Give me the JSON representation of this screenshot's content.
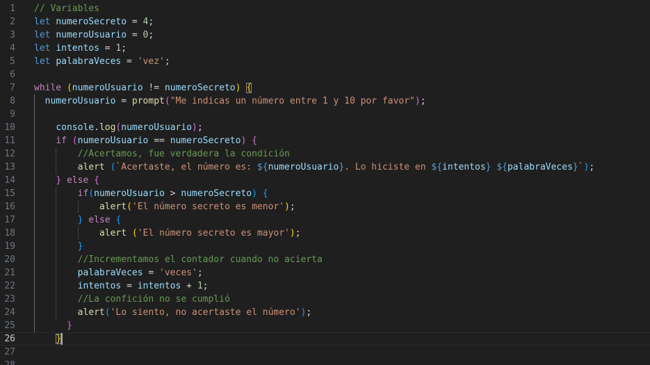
{
  "editor": {
    "language": "javascript",
    "active_line": 26,
    "lines": [
      {
        "n": "1",
        "indent": 0,
        "tokens": [
          {
            "t": "com",
            "v": "// Variables"
          }
        ]
      },
      {
        "n": "2",
        "indent": 0,
        "tokens": [
          {
            "t": "kw",
            "v": "let "
          },
          {
            "t": "var",
            "v": "numeroSecreto"
          },
          {
            "t": "op",
            "v": " = "
          },
          {
            "t": "num",
            "v": "4"
          },
          {
            "t": "op",
            "v": ";"
          }
        ]
      },
      {
        "n": "3",
        "indent": 0,
        "tokens": [
          {
            "t": "kw",
            "v": "let "
          },
          {
            "t": "var",
            "v": "numeroUsuario"
          },
          {
            "t": "op",
            "v": " = "
          },
          {
            "t": "num",
            "v": "0"
          },
          {
            "t": "op",
            "v": ";"
          }
        ]
      },
      {
        "n": "4",
        "indent": 0,
        "tokens": [
          {
            "t": "kw",
            "v": "let "
          },
          {
            "t": "var",
            "v": "intentos"
          },
          {
            "t": "op",
            "v": " = "
          },
          {
            "t": "num",
            "v": "1"
          },
          {
            "t": "op",
            "v": ";"
          }
        ]
      },
      {
        "n": "5",
        "indent": 0,
        "tokens": [
          {
            "t": "kw",
            "v": "let "
          },
          {
            "t": "var",
            "v": "palabraVeces"
          },
          {
            "t": "op",
            "v": " = "
          },
          {
            "t": "str",
            "v": "'vez'"
          },
          {
            "t": "op",
            "v": ";"
          }
        ]
      },
      {
        "n": "6",
        "indent": 0,
        "tokens": []
      },
      {
        "n": "7",
        "indent": 0,
        "tokens": [
          {
            "t": "ctrl",
            "v": "while "
          },
          {
            "t": "b1",
            "v": "("
          },
          {
            "t": "var",
            "v": "numeroUsuario"
          },
          {
            "t": "op",
            "v": " != "
          },
          {
            "t": "var",
            "v": "numeroSecreto"
          },
          {
            "t": "b1",
            "v": ")"
          },
          {
            "t": "op",
            "v": " "
          },
          {
            "t": "b1",
            "v": "{",
            "match": true
          }
        ]
      },
      {
        "n": "8",
        "indent": 2,
        "tokens": [
          {
            "t": "var",
            "v": "numeroUsuario"
          },
          {
            "t": "op",
            "v": " = "
          },
          {
            "t": "fn",
            "v": "prompt"
          },
          {
            "t": "b2",
            "v": "("
          },
          {
            "t": "str",
            "v": "\"Me indicas un número entre 1 y 10 por favor\""
          },
          {
            "t": "b2",
            "v": ")"
          },
          {
            "t": "op",
            "v": ";"
          }
        ]
      },
      {
        "n": "9",
        "indent": 0,
        "tokens": []
      },
      {
        "n": "10",
        "indent": 4,
        "tokens": [
          {
            "t": "var",
            "v": "console"
          },
          {
            "t": "op",
            "v": "."
          },
          {
            "t": "fn",
            "v": "log"
          },
          {
            "t": "b2",
            "v": "("
          },
          {
            "t": "var",
            "v": "numeroUsuario"
          },
          {
            "t": "b2",
            "v": ")"
          },
          {
            "t": "op",
            "v": ";"
          }
        ]
      },
      {
        "n": "11",
        "indent": 4,
        "tokens": [
          {
            "t": "ctrl",
            "v": "if "
          },
          {
            "t": "b2",
            "v": "("
          },
          {
            "t": "var",
            "v": "numeroUsuario"
          },
          {
            "t": "op",
            "v": " == "
          },
          {
            "t": "var",
            "v": "numeroSecreto"
          },
          {
            "t": "b2",
            "v": ")"
          },
          {
            "t": "op",
            "v": " "
          },
          {
            "t": "b2",
            "v": "{"
          }
        ]
      },
      {
        "n": "12",
        "indent": 8,
        "tokens": [
          {
            "t": "com",
            "v": "//Acertamos, fue verdadera la condición"
          }
        ]
      },
      {
        "n": "13",
        "indent": 8,
        "tokens": [
          {
            "t": "fn",
            "v": "alert"
          },
          {
            "t": "op",
            "v": " "
          },
          {
            "t": "b3",
            "v": "("
          },
          {
            "t": "str",
            "v": "`Acertaste, el número es: "
          },
          {
            "t": "tmpl",
            "v": "${"
          },
          {
            "t": "var",
            "v": "numeroUsuario"
          },
          {
            "t": "tmpl",
            "v": "}"
          },
          {
            "t": "str",
            "v": ". Lo hiciste en "
          },
          {
            "t": "tmpl",
            "v": "${"
          },
          {
            "t": "var",
            "v": "intentos"
          },
          {
            "t": "tmpl",
            "v": "}"
          },
          {
            "t": "str",
            "v": " "
          },
          {
            "t": "tmpl",
            "v": "${"
          },
          {
            "t": "var",
            "v": "palabraVeces"
          },
          {
            "t": "tmpl",
            "v": "}"
          },
          {
            "t": "str",
            "v": "`"
          },
          {
            "t": "b3",
            "v": ")"
          },
          {
            "t": "op",
            "v": ";"
          }
        ]
      },
      {
        "n": "14",
        "indent": 4,
        "tokens": [
          {
            "t": "b2",
            "v": "}"
          },
          {
            "t": "op",
            "v": " "
          },
          {
            "t": "ctrl",
            "v": "else "
          },
          {
            "t": "b2",
            "v": "{"
          }
        ]
      },
      {
        "n": "15",
        "indent": 8,
        "tokens": [
          {
            "t": "ctrl",
            "v": "if"
          },
          {
            "t": "b3",
            "v": "("
          },
          {
            "t": "var",
            "v": "numeroUsuario"
          },
          {
            "t": "op",
            "v": " > "
          },
          {
            "t": "var",
            "v": "numeroSecreto"
          },
          {
            "t": "b3",
            "v": ")"
          },
          {
            "t": "op",
            "v": " "
          },
          {
            "t": "b3",
            "v": "{"
          }
        ]
      },
      {
        "n": "16",
        "indent": 12,
        "tokens": [
          {
            "t": "fn",
            "v": "alert"
          },
          {
            "t": "b1",
            "v": "("
          },
          {
            "t": "str",
            "v": "'El número secreto es menor'"
          },
          {
            "t": "b1",
            "v": ")"
          },
          {
            "t": "op",
            "v": ";"
          }
        ]
      },
      {
        "n": "17",
        "indent": 8,
        "tokens": [
          {
            "t": "b3",
            "v": "}"
          },
          {
            "t": "op",
            "v": " "
          },
          {
            "t": "ctrl",
            "v": "else "
          },
          {
            "t": "b3",
            "v": "{"
          }
        ]
      },
      {
        "n": "18",
        "indent": 12,
        "tokens": [
          {
            "t": "fn",
            "v": "alert"
          },
          {
            "t": "op",
            "v": " "
          },
          {
            "t": "b1",
            "v": "("
          },
          {
            "t": "str",
            "v": "'El número secreto es mayor'"
          },
          {
            "t": "b1",
            "v": ")"
          },
          {
            "t": "op",
            "v": ";"
          }
        ]
      },
      {
        "n": "19",
        "indent": 8,
        "tokens": [
          {
            "t": "b3",
            "v": "}"
          }
        ]
      },
      {
        "n": "20",
        "indent": 8,
        "tokens": [
          {
            "t": "com",
            "v": "//Incrementamos el contador cuando no acierta"
          }
        ]
      },
      {
        "n": "21",
        "indent": 8,
        "tokens": [
          {
            "t": "var",
            "v": "palabraVeces"
          },
          {
            "t": "op",
            "v": " = "
          },
          {
            "t": "str",
            "v": "'veces'"
          },
          {
            "t": "op",
            "v": ";"
          }
        ]
      },
      {
        "n": "22",
        "indent": 8,
        "tokens": [
          {
            "t": "var",
            "v": "intentos"
          },
          {
            "t": "op",
            "v": " = "
          },
          {
            "t": "var",
            "v": "intentos"
          },
          {
            "t": "op",
            "v": " + "
          },
          {
            "t": "num",
            "v": "1"
          },
          {
            "t": "op",
            "v": ";"
          }
        ]
      },
      {
        "n": "23",
        "indent": 8,
        "tokens": [
          {
            "t": "com",
            "v": "//La confición no se cumplió"
          }
        ]
      },
      {
        "n": "24",
        "indent": 8,
        "tokens": [
          {
            "t": "fn",
            "v": "alert"
          },
          {
            "t": "b3",
            "v": "("
          },
          {
            "t": "str",
            "v": "'Lo siento, no acertaste el número'"
          },
          {
            "t": "b3",
            "v": ")"
          },
          {
            "t": "op",
            "v": ";"
          }
        ]
      },
      {
        "n": "25",
        "indent": 6,
        "tokens": [
          {
            "t": "b2",
            "v": "}"
          }
        ]
      },
      {
        "n": "26",
        "indent": 4,
        "tokens": [
          {
            "t": "b1",
            "v": "}",
            "match": true
          }
        ]
      },
      {
        "n": "27",
        "indent": 0,
        "tokens": []
      },
      {
        "n": "28",
        "indent": 0,
        "tokens": []
      }
    ]
  }
}
